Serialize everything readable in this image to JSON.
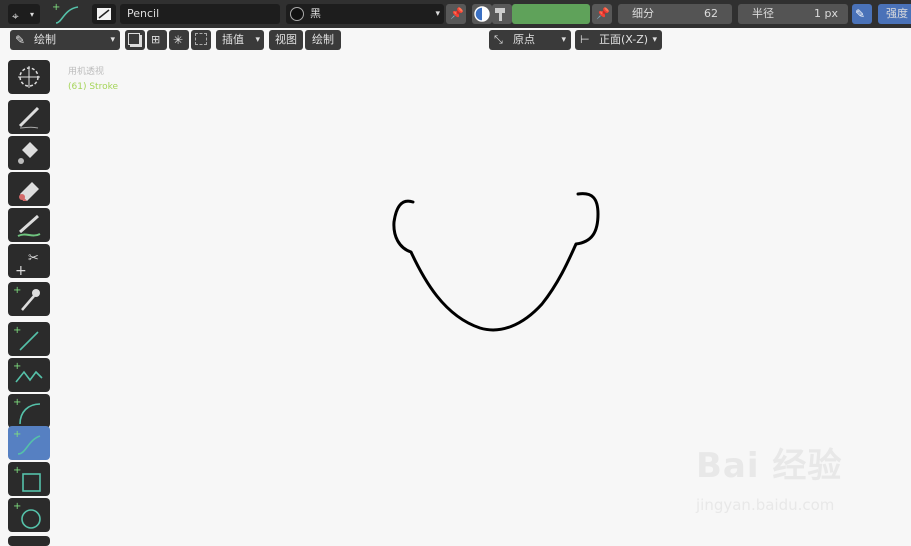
{
  "header": {
    "brush_name": "Pencil",
    "material_name": "黑",
    "subdivide_label": "细分",
    "subdivide_value": "62",
    "radius_label": "半径",
    "radius_value": "1 px",
    "strength_label": "强度",
    "color_swatch": "#5fa25a"
  },
  "subheader": {
    "mode_label": "绘制",
    "interp_label": "插值",
    "view_label": "视图",
    "draw_label": "绘制",
    "origin_label": "原点",
    "plane_label": "正面(X-Z)"
  },
  "viewport": {
    "hud_view": "用机透视",
    "hud_object": "(61) Stroke",
    "stroke_color": "#000000"
  },
  "toolbar": {
    "tools": [
      "cursor",
      "draw",
      "fill",
      "erase",
      "tint",
      "cutter",
      "eyedropper",
      "line",
      "polyline",
      "arc",
      "curve",
      "box",
      "circle"
    ],
    "active_tool": "curve"
  },
  "watermark": {
    "main": "Bai 经验",
    "sub": "jingyan.baidu.com"
  }
}
